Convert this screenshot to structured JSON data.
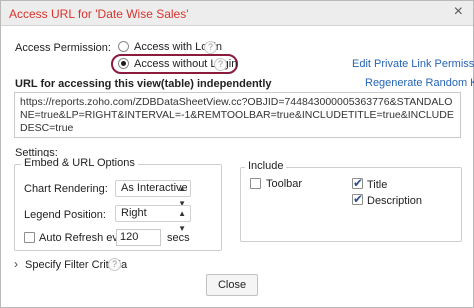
{
  "dialog": {
    "title": "Access URL for 'Date Wise Sales'",
    "close_glyph": "×"
  },
  "access": {
    "label": "Access Permission:",
    "with_login": "Access with Login",
    "without_login": "Access without Login",
    "help_glyph": "?",
    "selected": "without_login"
  },
  "links": {
    "edit_private": "Edit Private Link Permissions",
    "regenerate": "Regenerate Random Key"
  },
  "url": {
    "heading": "URL for accessing this view(table) independently",
    "value": "https://reports.zoho.com/ZDBDataSheetView.cc?OBJID=744843000005363776&STANDALONE=true&LP=RIGHT&INTERVAL=-1&REMTOOLBAR=true&INCLUDETITLE=true&INCLUDEDESC=true"
  },
  "settings": {
    "label": "Settings:",
    "embed": {
      "legend": "Embed & URL Options",
      "chart_rendering_label": "Chart Rendering:",
      "chart_rendering_value": "As Interactive",
      "legend_position_label": "Legend Position:",
      "legend_position_value": "Right",
      "auto_refresh_label": "Auto Refresh every",
      "auto_refresh_value": "120",
      "auto_refresh_unit": "secs",
      "auto_refresh_checked": false
    },
    "include": {
      "legend": "Include",
      "toolbar": "Toolbar",
      "title": "Title",
      "description": "Description",
      "toolbar_checked": false,
      "title_checked": true,
      "description_checked": true
    }
  },
  "filter": {
    "expander_glyph": "›",
    "label": "Specify Filter Criteria"
  },
  "footer": {
    "close_label": "Close"
  }
}
